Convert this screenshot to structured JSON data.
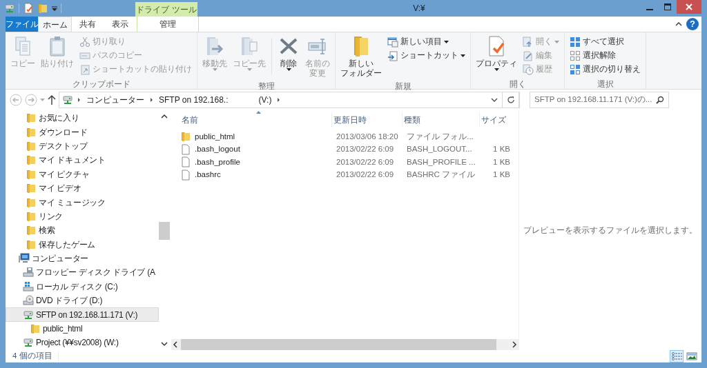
{
  "window": {
    "title": "V:¥",
    "help": "?"
  },
  "ribbon": {
    "tabs": [
      {
        "label": "ファイル",
        "kind": "file",
        "selected": false
      },
      {
        "label": "ホーム",
        "kind": "tab",
        "selected": true
      },
      {
        "label": "共有",
        "kind": "tab",
        "selected": false
      },
      {
        "label": "表示",
        "kind": "tab",
        "selected": false
      },
      {
        "label": "管理",
        "kind": "context",
        "context_label": "ドライブ ツール",
        "selected": false
      }
    ],
    "groups": [
      {
        "label": "クリップボード",
        "items": [
          {
            "kind": "large",
            "label": "コピー",
            "disabled": true
          },
          {
            "kind": "large",
            "label": "貼り付け",
            "disabled": true
          },
          {
            "kind": "small",
            "label": "切り取り",
            "disabled": true
          },
          {
            "kind": "small",
            "label": "パスのコピー",
            "disabled": true
          },
          {
            "kind": "small",
            "label": "ショートカットの貼り付け",
            "disabled": true
          }
        ]
      },
      {
        "label": "整理",
        "items": [
          {
            "kind": "large",
            "label": "移動先",
            "disabled": true,
            "dropdown": true
          },
          {
            "kind": "large",
            "label": "コピー先",
            "disabled": true,
            "dropdown": true
          },
          {
            "kind": "large",
            "label": "削除",
            "disabled": false,
            "dropdown": true,
            "divider_before": true
          },
          {
            "kind": "large",
            "lines": [
              "名前の",
              "変更"
            ],
            "disabled": true
          }
        ]
      },
      {
        "label": "新規",
        "items": [
          {
            "kind": "large",
            "lines": [
              "新しい",
              "フォルダー"
            ],
            "disabled": false
          },
          {
            "kind": "small",
            "label": "新しい項目",
            "disabled": false,
            "dropdown": true
          },
          {
            "kind": "small",
            "label": "ショートカット",
            "disabled": false,
            "dropdown": true
          }
        ]
      },
      {
        "label": "開く",
        "items": [
          {
            "kind": "large",
            "label": "プロパティ",
            "disabled": false,
            "dropdown": true
          },
          {
            "kind": "small",
            "label": "開く",
            "disabled": true,
            "dropdown": true
          },
          {
            "kind": "small",
            "label": "編集",
            "disabled": true
          },
          {
            "kind": "small",
            "label": "履歴",
            "disabled": true
          }
        ]
      },
      {
        "label": "選択",
        "items": [
          {
            "kind": "small",
            "label": "すべて選択",
            "disabled": false
          },
          {
            "kind": "small",
            "label": "選択解除",
            "disabled": false
          },
          {
            "kind": "small",
            "label": "選択の切り替え",
            "disabled": false
          }
        ]
      }
    ]
  },
  "address": {
    "breadcrumbs": [
      {
        "label": "コンピューター"
      },
      {
        "label": "SFTP on 192.168.:",
        "suffix": "(V:)"
      }
    ]
  },
  "search": {
    "placeholder": "SFTP on 192.168.11.171 (V:)の..."
  },
  "nav": {
    "favorites": [
      {
        "label": "お気に入り",
        "selected": false
      },
      {
        "label": "ダウンロード",
        "selected": false
      },
      {
        "label": "デスクトップ",
        "selected": false
      },
      {
        "label": "マイ ドキュメント",
        "selected": false
      },
      {
        "label": "マイ ピクチャ",
        "selected": false
      },
      {
        "label": "マイ ビデオ",
        "selected": false
      },
      {
        "label": "マイ ミュージック",
        "selected": false
      },
      {
        "label": "リンク",
        "selected": false
      },
      {
        "label": "検索",
        "selected": false
      },
      {
        "label": "保存したゲーム",
        "selected": false
      }
    ],
    "computer": {
      "label": "コンピューター",
      "selected": false,
      "children": [
        {
          "label": "フロッピー ディスク ドライブ (A",
          "kind": "floppy",
          "selected": false
        },
        {
          "label": "ローカル ディスク (C:)",
          "kind": "disk",
          "selected": false
        },
        {
          "label": "DVD ドライブ (D:)",
          "kind": "dvd",
          "selected": false
        },
        {
          "label": "SFTP on 192.168.11.171 (V:)",
          "kind": "network",
          "selected": true,
          "children": [
            {
              "label": "public_html",
              "kind": "folder",
              "selected": false
            }
          ]
        },
        {
          "label": "Project (¥¥sv2008) (W:)",
          "kind": "network",
          "selected": false
        }
      ]
    }
  },
  "file_list": {
    "columns": [
      {
        "label": "名前",
        "sorted": true
      },
      {
        "label": "更新日時",
        "sorted": false
      },
      {
        "label": "種類",
        "sorted": false
      },
      {
        "label": "サイズ",
        "sorted": false
      }
    ],
    "rows": [
      {
        "kind": "folder",
        "name": "public_html",
        "modified": "2013/03/06 18:20",
        "type": "ファイル フォル..."
      },
      {
        "kind": "file",
        "name": ".bash_logout",
        "modified": "2013/02/22 6:09",
        "type": "BASH_LOGOUT...",
        "size": "1 KB"
      },
      {
        "kind": "file",
        "name": ".bash_profile",
        "modified": "2013/02/22 6:09",
        "type": "BASH_PROFILE ...",
        "size": "1 KB"
      },
      {
        "kind": "file",
        "name": ".bashrc",
        "modified": "2013/02/22 6:09",
        "type": "BASHRC ファイル",
        "size": "1 KB"
      }
    ]
  },
  "preview": {
    "message": "プレビューを表示するファイルを選択します。"
  },
  "status_bar": {
    "item_count": "4 個の項目",
    "views": [
      {
        "selected": true
      },
      {
        "selected": false
      }
    ]
  }
}
